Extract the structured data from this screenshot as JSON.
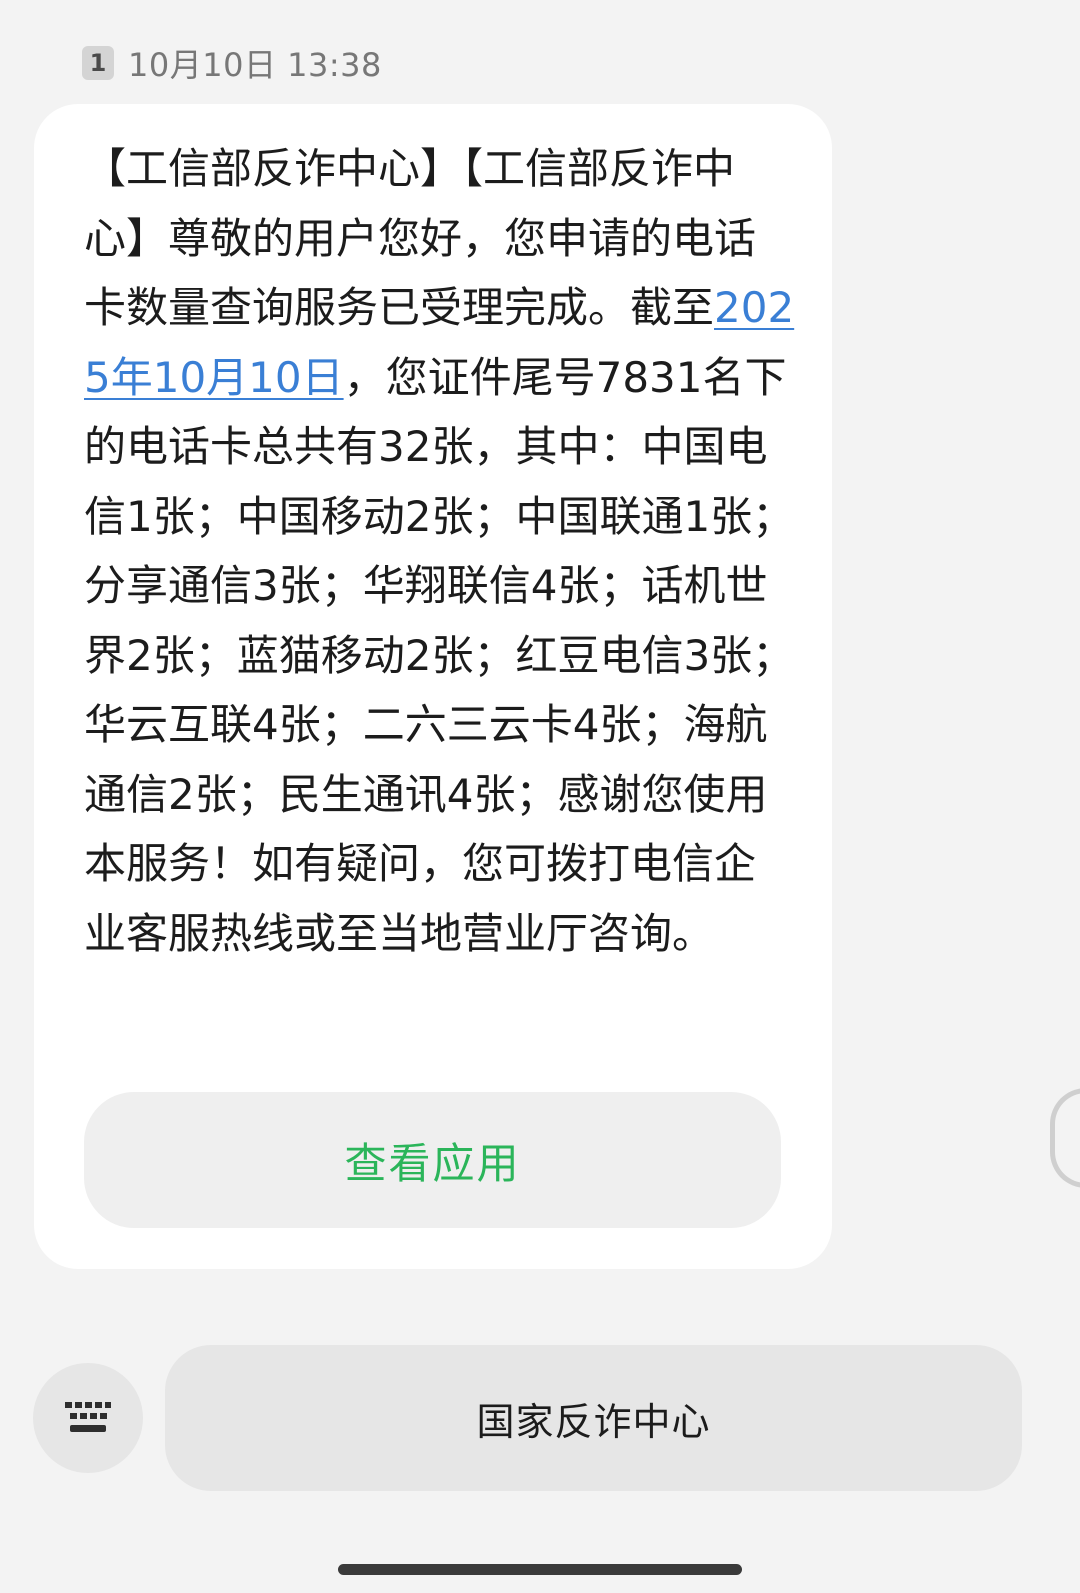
{
  "message": {
    "sim_label": "1",
    "timestamp": "10月10日 13:38",
    "text_before_link": "【工信部反诈中心】【工信部反诈中心】尊敬的用户您好，您申请的电话卡数量查询服务已受理完成。截至",
    "date_link": "2025年10月10日",
    "text_after_link": "，您证件尾号7831名下的电话卡总共有32张，其中：中国电信1张；中国移动2张；中国联通1张；分享通信3张；华翔联信4张；话机世界2张；蓝猫移动2张；红豆电信3张；华云互联4张；二六三云卡4张；海航通信2张；民生通讯4张；感谢您使用本服务！如有疑问，您可拨打电信企业客服热线或至当地营业厅咨询。",
    "action_button": "查看应用"
  },
  "bottom_bar": {
    "keyboard_icon": "keyboard-icon",
    "menu_label": "国家反诈中心"
  },
  "colors": {
    "background": "#f3f3f3",
    "bubble": "#ffffff",
    "link": "#3a7fd5",
    "action_green": "#2bb55a"
  }
}
